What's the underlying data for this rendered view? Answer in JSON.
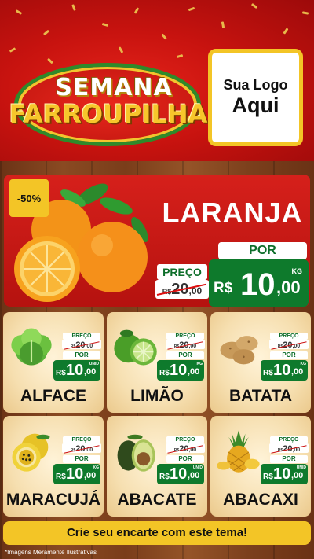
{
  "header": {
    "title_line1": "SEMANA",
    "title_line2": "FARROUPILHA",
    "logo_line1": "Sua Logo",
    "logo_line2": "Aqui"
  },
  "hero": {
    "discount": "-50%",
    "product": "LARANJA",
    "preco_label": "PREÇO",
    "old_currency": "R$",
    "old_value": "20",
    "old_cents": ",00",
    "por_label": "POR",
    "currency": "R$",
    "value": "10",
    "cents": ",00",
    "unit": "KG"
  },
  "products": [
    {
      "name": "ALFACE",
      "preco_label": "PREÇO",
      "old_currency": "R$",
      "old_value": "20",
      "old_cents": ",00",
      "por_label": "POR",
      "currency": "R$",
      "value": "10",
      "cents": ",00",
      "unit": "UNID",
      "icon": "lettuce-icon"
    },
    {
      "name": "LIMÃO",
      "preco_label": "PREÇO",
      "old_currency": "R$",
      "old_value": "20",
      "old_cents": ",00",
      "por_label": "POR",
      "currency": "R$",
      "value": "10",
      "cents": ",00",
      "unit": "KG",
      "icon": "lime-icon"
    },
    {
      "name": "BATATA",
      "preco_label": "PREÇO",
      "old_currency": "R$",
      "old_value": "20",
      "old_cents": ",00",
      "por_label": "POR",
      "currency": "R$",
      "value": "10",
      "cents": ",00",
      "unit": "KG",
      "icon": "potato-icon"
    },
    {
      "name": "MARACUJÁ",
      "preco_label": "PREÇO",
      "old_currency": "R$",
      "old_value": "20",
      "old_cents": ",00",
      "por_label": "POR",
      "currency": "R$",
      "value": "10",
      "cents": ",00",
      "unit": "KG",
      "icon": "passion-fruit-icon"
    },
    {
      "name": "ABACATE",
      "preco_label": "PREÇO",
      "old_currency": "R$",
      "old_value": "20",
      "old_cents": ",00",
      "por_label": "POR",
      "currency": "R$",
      "value": "10",
      "cents": ",00",
      "unit": "UNID",
      "icon": "avocado-icon"
    },
    {
      "name": "ABACAXI",
      "preco_label": "PREÇO",
      "old_currency": "R$",
      "old_value": "20",
      "old_cents": ",00",
      "por_label": "POR",
      "currency": "R$",
      "value": "10",
      "cents": ",00",
      "unit": "UNID",
      "icon": "pineapple-icon"
    }
  ],
  "cta": "Crie seu encarte com este tema!",
  "footnote": "*Imagens Meramente Ilustrativas",
  "colors": {
    "red": "#d6201b",
    "green": "#0e7a2c",
    "yellow": "#f3c526",
    "card_bg": "#f6dfb0",
    "wood": "#8a4a22"
  }
}
